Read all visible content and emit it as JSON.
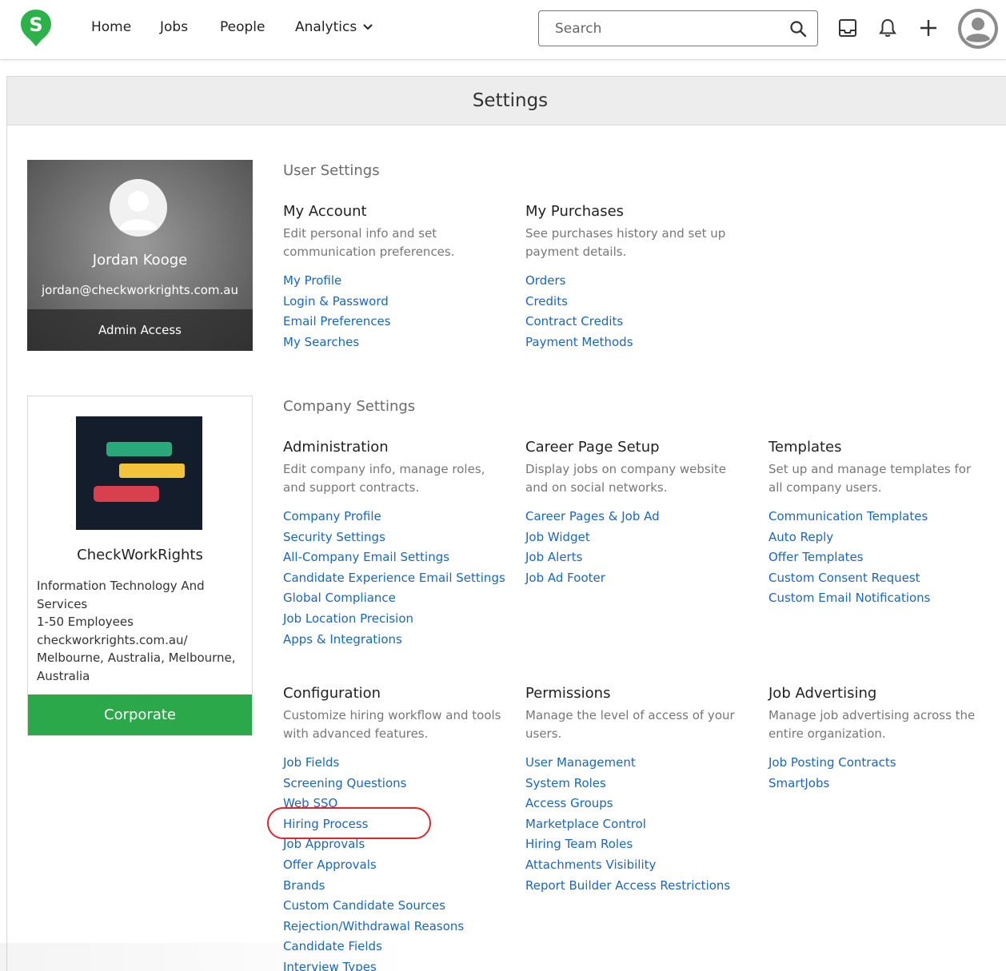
{
  "nav": {
    "home": "Home",
    "jobs": "Jobs",
    "people": "People",
    "analytics": "Analytics",
    "search_placeholder": "Search"
  },
  "page": {
    "title": "Settings"
  },
  "user_card": {
    "name": "Jordan Kooge",
    "email": "jordan@checkworkrights.com.au",
    "access": "Admin Access"
  },
  "company_card": {
    "name": "CheckWorkRights",
    "info": [
      "Information Technology And Services",
      "1-50 Employees",
      "checkworkrights.com.au/",
      "Melbourne, Australia, Melbourne, Australia"
    ],
    "plan": "Corporate"
  },
  "user_settings": {
    "title": "User Settings",
    "my_account": {
      "title": "My Account",
      "desc": "Edit personal info and set communication preferences.",
      "links": [
        "My Profile",
        "Login & Password",
        "Email Preferences",
        "My Searches"
      ]
    },
    "my_purchases": {
      "title": "My Purchases",
      "desc": "See purchases history and set up payment details.",
      "links": [
        "Orders",
        "Credits",
        "Contract Credits",
        "Payment Methods"
      ]
    }
  },
  "company_settings": {
    "title": "Company Settings",
    "administration": {
      "title": "Administration",
      "desc": "Edit company info, manage roles, and support contracts.",
      "links": [
        "Company Profile",
        "Security Settings",
        "All-Company Email Settings",
        "Candidate Experience Email Settings",
        "Global Compliance",
        "Job Location Precision",
        "Apps & Integrations"
      ]
    },
    "career_page": {
      "title": "Career Page Setup",
      "desc": "Display jobs on company website and on social networks.",
      "links": [
        "Career Pages & Job Ad",
        "Job Widget",
        "Job Alerts",
        "Job Ad Footer"
      ]
    },
    "templates": {
      "title": "Templates",
      "desc": "Set up and manage templates for all company users.",
      "links": [
        "Communication Templates",
        "Auto Reply",
        "Offer Templates",
        "Custom Consent Request",
        "Custom Email Notifications"
      ]
    },
    "configuration": {
      "title": "Configuration",
      "desc": "Customize hiring workflow and tools with advanced features.",
      "links": [
        "Job Fields",
        "Screening Questions",
        "Web SSO",
        "Hiring Process",
        "Job Approvals",
        "Offer Approvals",
        "Brands",
        "Custom Candidate Sources",
        "Rejection/Withdrawal Reasons",
        "Candidate Fields",
        "Interview Types"
      ]
    },
    "permissions": {
      "title": "Permissions",
      "desc": "Manage the level of access of your users.",
      "links": [
        "User Management",
        "System Roles",
        "Access Groups",
        "Marketplace Control",
        "Hiring Team Roles",
        "Attachments Visibility",
        "Report Builder Access Restrictions"
      ]
    },
    "job_advertising": {
      "title": "Job Advertising",
      "desc": "Manage job advertising across the entire organization.",
      "links": [
        "Job Posting Contracts",
        "SmartJobs"
      ]
    }
  },
  "colors": {
    "link": "#1a66c2",
    "plan_green": "#2aa84a",
    "logo_green": "#2db24a",
    "highlight_red": "#e0262b"
  }
}
